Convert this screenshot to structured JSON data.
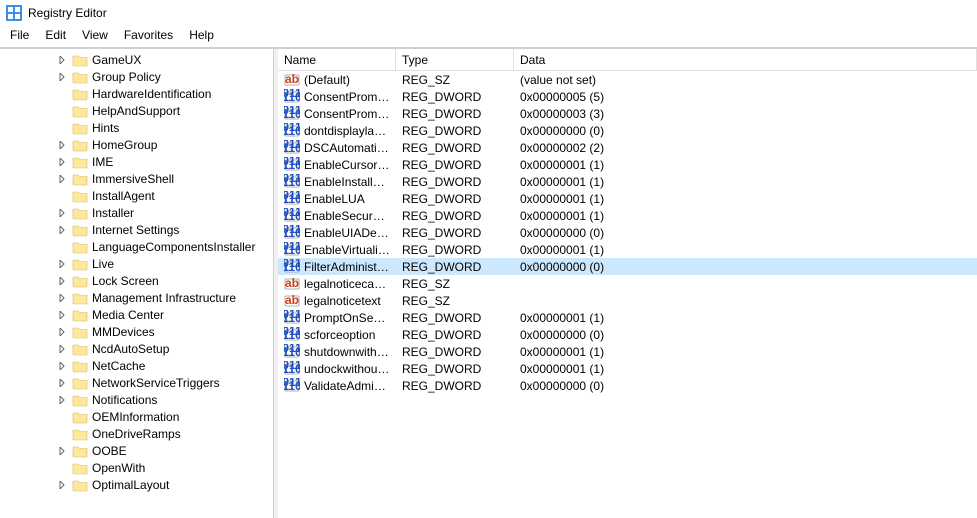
{
  "window": {
    "title": "Registry Editor"
  },
  "menu": {
    "file": "File",
    "edit": "Edit",
    "view": "View",
    "favorites": "Favorites",
    "help": "Help"
  },
  "columns": {
    "name": "Name",
    "type": "Type",
    "data": "Data"
  },
  "tree": {
    "items": [
      {
        "label": "GameUX",
        "expandable": true
      },
      {
        "label": "Group Policy",
        "expandable": true
      },
      {
        "label": "HardwareIdentification",
        "expandable": false
      },
      {
        "label": "HelpAndSupport",
        "expandable": false
      },
      {
        "label": "Hints",
        "expandable": false
      },
      {
        "label": "HomeGroup",
        "expandable": true
      },
      {
        "label": "IME",
        "expandable": true
      },
      {
        "label": "ImmersiveShell",
        "expandable": true
      },
      {
        "label": "InstallAgent",
        "expandable": false
      },
      {
        "label": "Installer",
        "expandable": true
      },
      {
        "label": "Internet Settings",
        "expandable": true
      },
      {
        "label": "LanguageComponentsInstaller",
        "expandable": false
      },
      {
        "label": "Live",
        "expandable": true
      },
      {
        "label": "Lock Screen",
        "expandable": true
      },
      {
        "label": "Management Infrastructure",
        "expandable": true
      },
      {
        "label": "Media Center",
        "expandable": true
      },
      {
        "label": "MMDevices",
        "expandable": true
      },
      {
        "label": "NcdAutoSetup",
        "expandable": true
      },
      {
        "label": "NetCache",
        "expandable": true
      },
      {
        "label": "NetworkServiceTriggers",
        "expandable": true
      },
      {
        "label": "Notifications",
        "expandable": true
      },
      {
        "label": "OEMInformation",
        "expandable": false
      },
      {
        "label": "OneDriveRamps",
        "expandable": false
      },
      {
        "label": "OOBE",
        "expandable": true
      },
      {
        "label": "OpenWith",
        "expandable": false
      },
      {
        "label": "OptimalLayout",
        "expandable": true
      }
    ]
  },
  "values": [
    {
      "name": "(Default)",
      "type": "REG_SZ",
      "data": "(value not set)",
      "kind": "sz"
    },
    {
      "name": "ConsentPromptBehaviorAdmin",
      "display": "ConsentPrompt...",
      "type": "REG_DWORD",
      "data": "0x00000005 (5)",
      "kind": "dw"
    },
    {
      "name": "ConsentPromptBehaviorUser",
      "display": "ConsentPrompt...",
      "type": "REG_DWORD",
      "data": "0x00000003 (3)",
      "kind": "dw"
    },
    {
      "name": "dontdisplaylastusername",
      "display": "dontdisplaylast...",
      "type": "REG_DWORD",
      "data": "0x00000000 (0)",
      "kind": "dw"
    },
    {
      "name": "DSCAutomationHostEnabled",
      "display": "DSCAutomatio...",
      "type": "REG_DWORD",
      "data": "0x00000002 (2)",
      "kind": "dw"
    },
    {
      "name": "EnableCursorSuppression",
      "display": "EnableCursorSu...",
      "type": "REG_DWORD",
      "data": "0x00000001 (1)",
      "kind": "dw"
    },
    {
      "name": "EnableInstallerDetection",
      "display": "EnableInstallerD...",
      "type": "REG_DWORD",
      "data": "0x00000001 (1)",
      "kind": "dw"
    },
    {
      "name": "EnableLUA",
      "display": "EnableLUA",
      "type": "REG_DWORD",
      "data": "0x00000001 (1)",
      "kind": "dw"
    },
    {
      "name": "EnableSecureUIAPaths",
      "display": "EnableSecureUI...",
      "type": "REG_DWORD",
      "data": "0x00000001 (1)",
      "kind": "dw"
    },
    {
      "name": "EnableUIADesktopToggle",
      "display": "EnableUIADeskt...",
      "type": "REG_DWORD",
      "data": "0x00000000 (0)",
      "kind": "dw"
    },
    {
      "name": "EnableVirtualization",
      "display": "EnableVirtualiza...",
      "type": "REG_DWORD",
      "data": "0x00000001 (1)",
      "kind": "dw"
    },
    {
      "name": "FilterAdministratorToken",
      "display": "FilterAdministra...",
      "type": "REG_DWORD",
      "data": "0x00000000 (0)",
      "kind": "dw",
      "selected": true
    },
    {
      "name": "legalnoticecaption",
      "display": "legalnoticecapti...",
      "type": "REG_SZ",
      "data": "",
      "kind": "sz"
    },
    {
      "name": "legalnoticetext",
      "display": "legalnoticetext",
      "type": "REG_SZ",
      "data": "",
      "kind": "sz"
    },
    {
      "name": "PromptOnSecureDesktop",
      "display": "PromptOnSecur...",
      "type": "REG_DWORD",
      "data": "0x00000001 (1)",
      "kind": "dw"
    },
    {
      "name": "scforceoption",
      "display": "scforceoption",
      "type": "REG_DWORD",
      "data": "0x00000000 (0)",
      "kind": "dw"
    },
    {
      "name": "shutdownwithoutlogon",
      "display": "shutdownwitho...",
      "type": "REG_DWORD",
      "data": "0x00000001 (1)",
      "kind": "dw"
    },
    {
      "name": "undockwithoutlogon",
      "display": "undockwithoutl...",
      "type": "REG_DWORD",
      "data": "0x00000001 (1)",
      "kind": "dw"
    },
    {
      "name": "ValidateAdminCodeSignatures",
      "display": "ValidateAdminC...",
      "type": "REG_DWORD",
      "data": "0x00000000 (0)",
      "kind": "dw"
    }
  ]
}
